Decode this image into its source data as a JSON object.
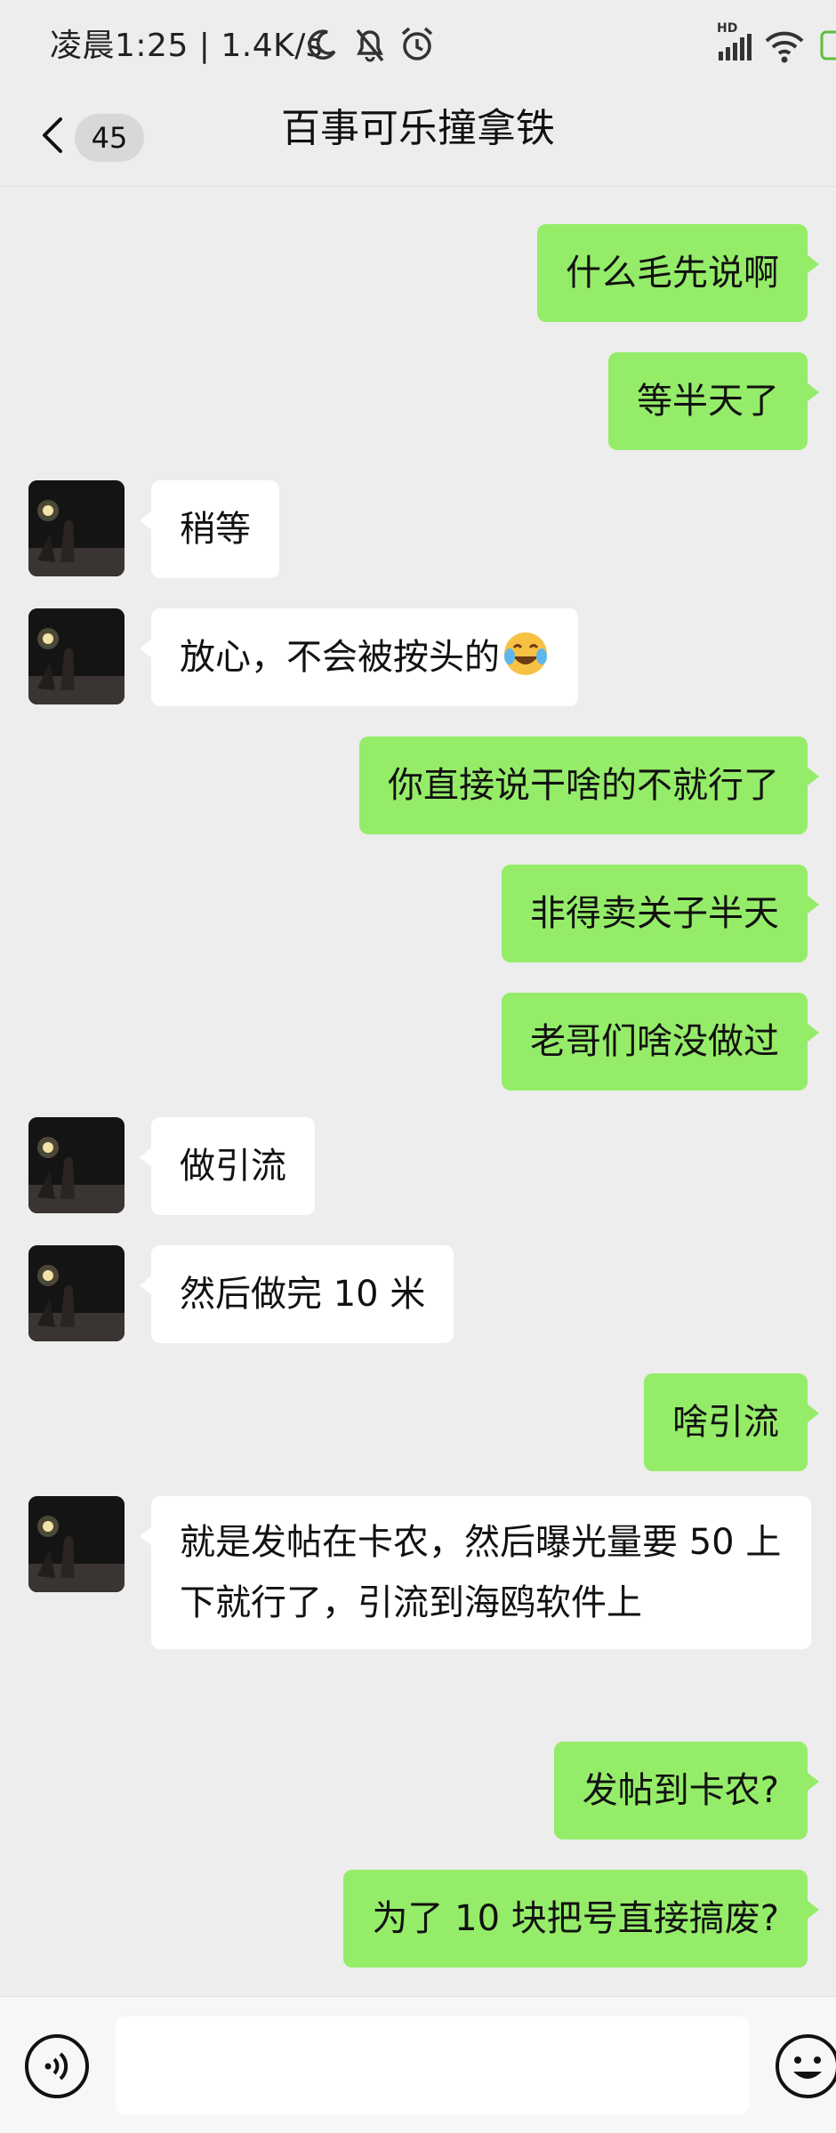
{
  "status_bar": {
    "text": "凌晨1:25 | 1.4K/s",
    "icons": [
      "moon-icon",
      "mute-bell-icon",
      "alarm-icon",
      "hd-signal-icon",
      "wifi-icon",
      "battery-icon"
    ],
    "hd_label": "HD"
  },
  "header": {
    "unread_count": "45",
    "title": "百事可乐撞拿铁"
  },
  "colors": {
    "background": "#ededed",
    "outgoing_bubble": "#95ec69",
    "incoming_bubble": "#ffffff"
  },
  "messages": [
    {
      "side": "out",
      "text": "什么毛先说啊"
    },
    {
      "side": "out",
      "text": "等半天了"
    },
    {
      "side": "in",
      "text": "稍等"
    },
    {
      "side": "in",
      "text": "放心，不会被按头的",
      "emoji": "tears-of-joy-emoji"
    },
    {
      "side": "out",
      "text": "你直接说干啥的不就行了"
    },
    {
      "side": "out",
      "text": "非得卖关子半天"
    },
    {
      "side": "out",
      "text": "老哥们啥没做过"
    },
    {
      "side": "in",
      "text": "做引流"
    },
    {
      "side": "in",
      "text": "然后做完 10 米"
    },
    {
      "side": "out",
      "text": "啥引流"
    },
    {
      "side": "in",
      "text": "就是发帖在卡农，然后曝光量要 50 上下就行了，引流到海鸥软件上"
    },
    {
      "side": "out",
      "text": "发帖到卡农?"
    },
    {
      "side": "out",
      "text": "为了 10 块把号直接搞废?"
    }
  ],
  "bottom_bar": {
    "left_icon": "voice-icon",
    "right_icon": "emoji-icon"
  }
}
